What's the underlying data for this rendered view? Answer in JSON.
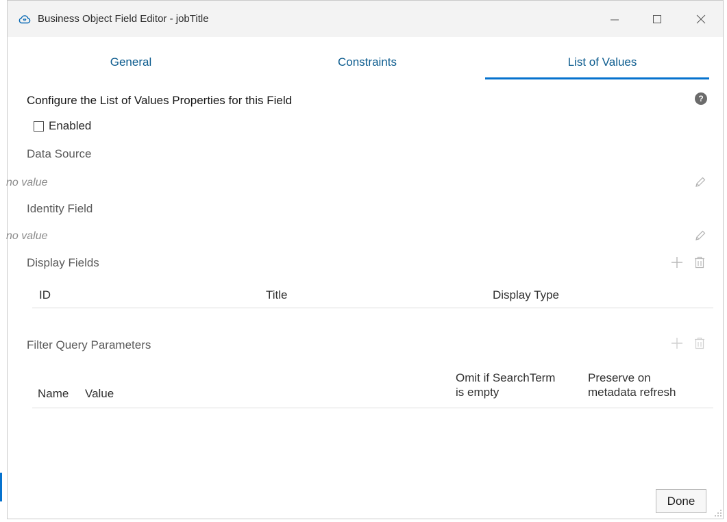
{
  "window": {
    "title": "Business Object Field Editor - jobTitle",
    "icon": "cloud-app-icon"
  },
  "titlebar_buttons": {
    "minimize": "minimize-icon",
    "maximize": "maximize-icon",
    "close": "close-icon"
  },
  "tabs": [
    {
      "label": "General"
    },
    {
      "label": "Constraints"
    },
    {
      "label": "List of Values",
      "active": true
    }
  ],
  "section": {
    "heading": "Configure the List of Values Properties for this Field",
    "enabled_label": "Enabled",
    "enabled_checked": false
  },
  "data_source": {
    "label": "Data Source",
    "value": "no value"
  },
  "identity_field": {
    "label": "Identity Field",
    "value": "no value"
  },
  "display_fields": {
    "label": "Display Fields",
    "columns": [
      "ID",
      "Title",
      "Display Type"
    ]
  },
  "filter_query": {
    "label": "Filter Query Parameters",
    "columns": {
      "name": "Name",
      "value": "Value",
      "omit_line1": "Omit if SearchTerm",
      "omit_line2": "is empty",
      "preserve_line1": "Preserve on",
      "preserve_line2": "metadata refresh"
    }
  },
  "footer": {
    "done_label": "Done"
  },
  "colors": {
    "accent": "#0572ce",
    "tab_text": "#0b5b8e",
    "muted_text": "#8a8a8a"
  }
}
